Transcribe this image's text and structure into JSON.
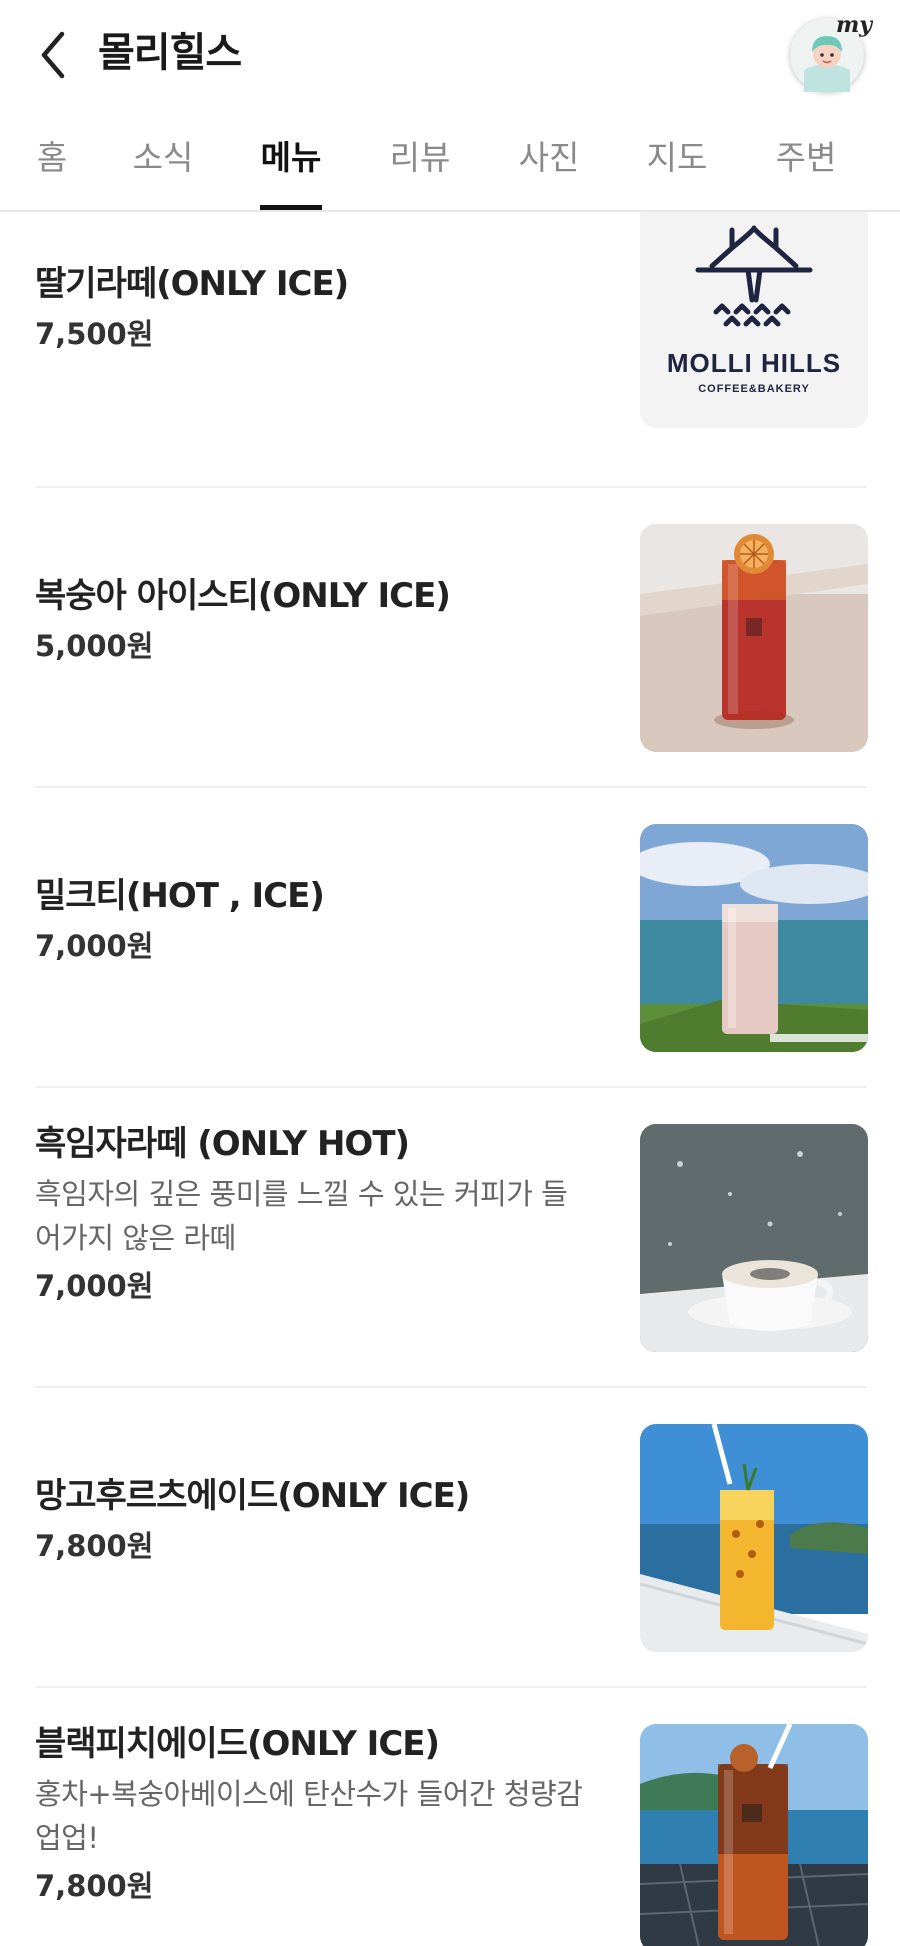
{
  "header": {
    "title": "몰리힐스",
    "back_icon": "chevron-left-icon",
    "avatar_label": "my"
  },
  "tabs": [
    {
      "label": "홈",
      "active": false
    },
    {
      "label": "소식",
      "active": false
    },
    {
      "label": "메뉴",
      "active": true
    },
    {
      "label": "리뷰",
      "active": false
    },
    {
      "label": "사진",
      "active": false
    },
    {
      "label": "지도",
      "active": false
    },
    {
      "label": "주변",
      "active": false
    }
  ],
  "logo": {
    "brand": "MOLLI HILLS",
    "tagline": "COFFEE&BAKERY"
  },
  "menu": [
    {
      "name": "딸기라떼(ONLY ICE)",
      "desc": "",
      "price": "7,500원",
      "image": "logo"
    },
    {
      "name": "복숭아 아이스티(ONLY ICE)",
      "desc": "",
      "price": "5,000원",
      "image": "iced-tea"
    },
    {
      "name": "밀크티(HOT , ICE)",
      "desc": "",
      "price": "7,000원",
      "image": "milk-tea"
    },
    {
      "name": "흑임자라떼 (ONLY HOT)",
      "desc_line1": "흑임자의 깊은 풍미를 느낄 수 있는 커피가 들",
      "desc_line2": "어가지 않은 라떼",
      "price": "7,000원",
      "image": "latte"
    },
    {
      "name": "망고후르츠에이드(ONLY ICE)",
      "desc": "",
      "price": "7,800원",
      "image": "mango-ade"
    },
    {
      "name": "블랙피치에이드(ONLY ICE)",
      "desc_line1": "홍차+복숭아베이스에 탄산수가 들어간 청량감",
      "desc_line2": "업업!",
      "price": "7,800원",
      "image": "peach-ade"
    }
  ],
  "colors": {
    "accent": "#111111",
    "tab_inactive": "#8a8a8a",
    "divider": "#eeeeee"
  }
}
